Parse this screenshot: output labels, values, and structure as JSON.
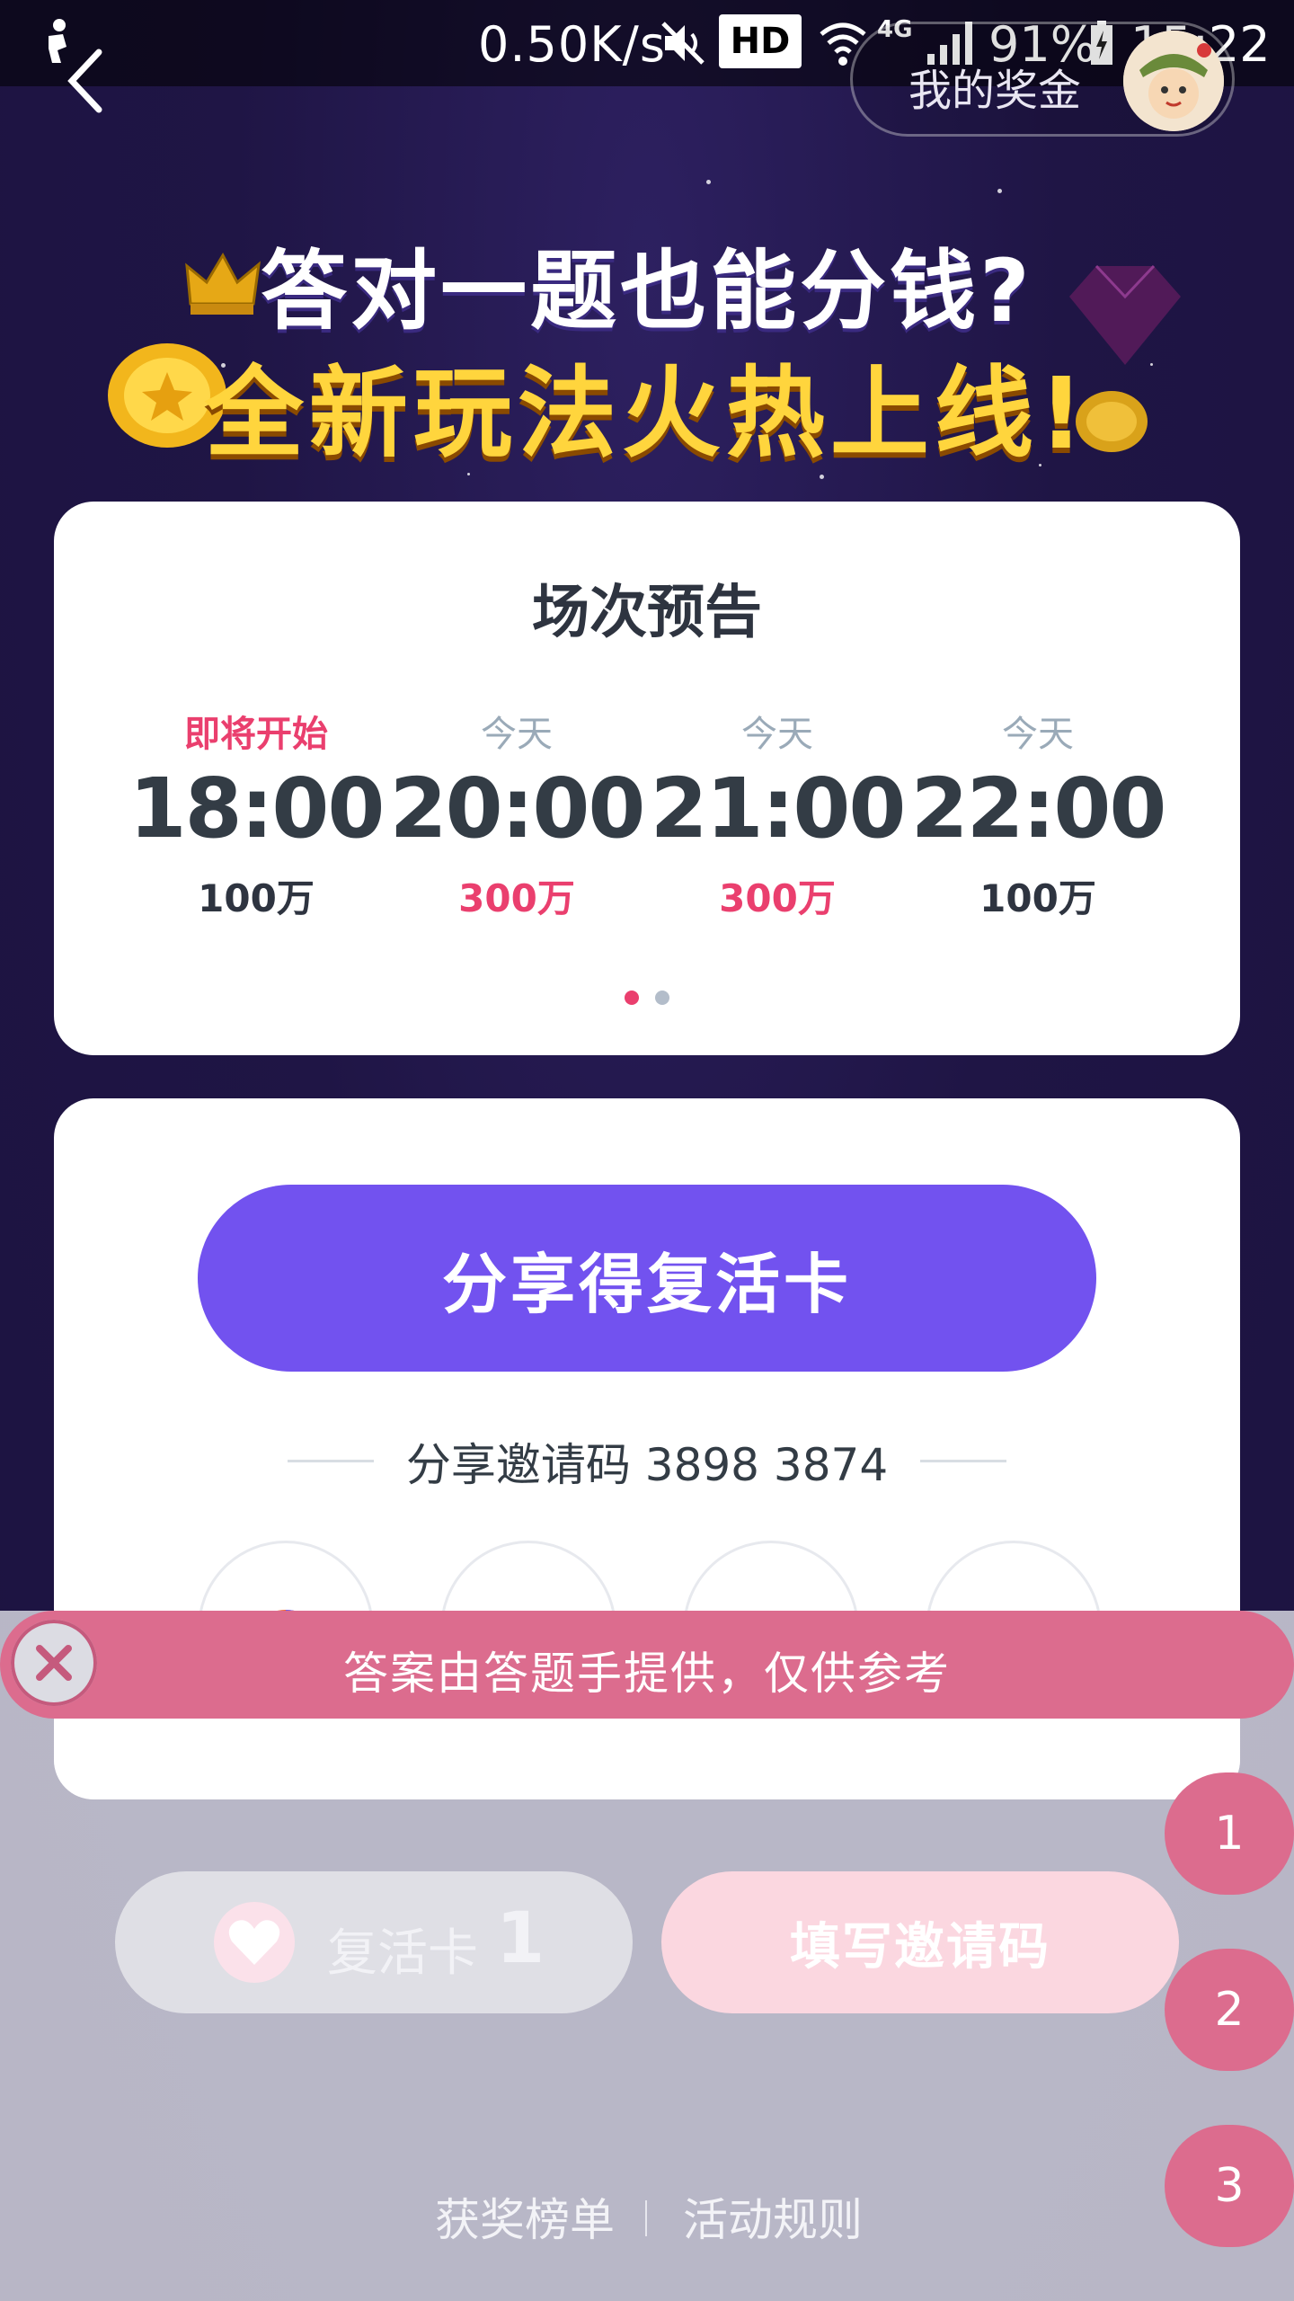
{
  "status_bar": {
    "net_speed": "0.50K/s",
    "hd": "HD",
    "network": "4G",
    "battery": "91%",
    "time": "15:22"
  },
  "header": {
    "bonus_label": "我的奖金"
  },
  "banner": {
    "line1": "答对一题也能分钱?",
    "line2": "全新玩法火热上线!"
  },
  "schedule": {
    "title": "场次预告",
    "sessions": [
      {
        "tag": "即将开始",
        "time": "18:00",
        "prize": "100万"
      },
      {
        "tag": "今天",
        "time": "20:00",
        "prize": "300万"
      },
      {
        "tag": "今天",
        "time": "21:00",
        "prize": "300万"
      },
      {
        "tag": "今天",
        "time": "22:00",
        "prize": "100万"
      }
    ]
  },
  "share": {
    "button_label": "分享得复活卡",
    "invite_code_text": "分享邀请码 3898 3874"
  },
  "toast": {
    "message": "答案由答题手提供，仅供参考"
  },
  "revive": {
    "label": "复活卡",
    "count": "1"
  },
  "invite_button": "填写邀请码",
  "answers": [
    "1",
    "2",
    "3"
  ],
  "footer": {
    "leaderboard": "获奖榜单",
    "rules": "活动规则"
  },
  "colors": {
    "background": "#1f1545",
    "accent_purple": "#7252ef",
    "accent_pink": "#ea3f6e",
    "toast_pink": "#dc6c8e"
  }
}
